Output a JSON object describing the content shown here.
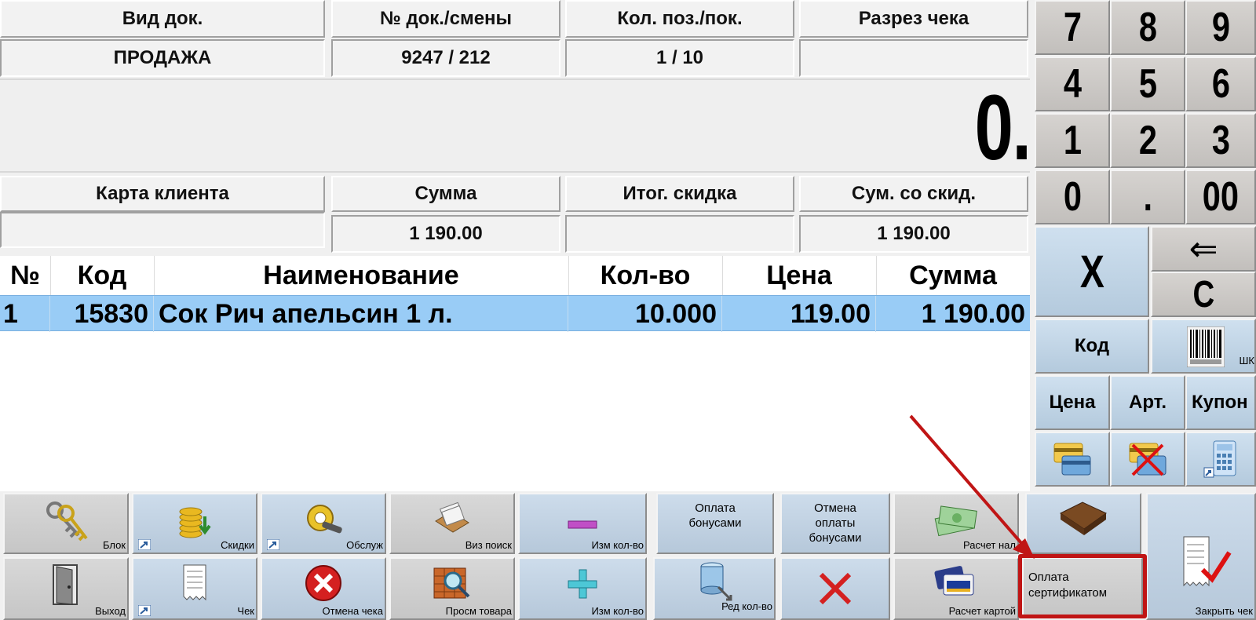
{
  "header": {
    "doc_type_label": "Вид док.",
    "doc_type_value": "ПРОДАЖА",
    "doc_num_label": "№ док./смены",
    "doc_num_value": "9247 / 212",
    "positions_label": "Кол. поз./пок.",
    "positions_value": "1 / 10",
    "receipt_cut_label": "Разрез чека",
    "receipt_cut_value": ""
  },
  "display": {
    "value": "0."
  },
  "summary": {
    "client_card_label": "Карта клиента",
    "client_card_value": "",
    "sum_label": "Сумма",
    "sum_value": "1 190.00",
    "total_discount_label": "Итог. скидка",
    "total_discount_value": "",
    "sum_discount_label": "Сум. со скид.",
    "sum_discount_value": "1 190.00"
  },
  "table": {
    "columns": [
      "№",
      "Код",
      "Наименование",
      "Кол-во",
      "Цена",
      "Сумма"
    ],
    "rows": [
      {
        "num": "1",
        "code": "15830",
        "name": "Сок Рич апельсин 1 л.",
        "qty": "10.000",
        "price": "119.00",
        "sum": "1 190.00"
      }
    ]
  },
  "keypad": {
    "k7": "7",
    "k8": "8",
    "k9": "9",
    "k4": "4",
    "k5": "5",
    "k6": "6",
    "k1": "1",
    "k2": "2",
    "k3": "3",
    "k0": "0",
    "kdot": ".",
    "k00": "00",
    "multiply": "X",
    "backspace": "⇐",
    "clear": "C",
    "code": "Код",
    "barcode_label": "ШК",
    "price": "Цена",
    "article": "Арт.",
    "coupon": "Купон"
  },
  "buttons": {
    "block": "Блок",
    "discounts": "Скидки",
    "service": "Обслуж",
    "visual_search": "Виз поиск",
    "qty_minus": "Изм кол-во",
    "pay_bonus": "Оплата бонусами",
    "cancel_bonus": "Отмена оплаты бонусами",
    "cash_calc": "Расчет нал",
    "exit": "Выход",
    "receipt": "Чек",
    "cancel_receipt": "Отмена чека",
    "view_goods": "Просм товара",
    "qty_plus": "Изм кол-во",
    "edit_qty": "Ред кол-во",
    "card_calc": "Расчет картой",
    "pay_certificate": "Оплата сертификатом",
    "close_receipt": "Закрыть чек"
  },
  "colors": {
    "selected_row": "#99ccf6",
    "highlight": "#c01515"
  }
}
